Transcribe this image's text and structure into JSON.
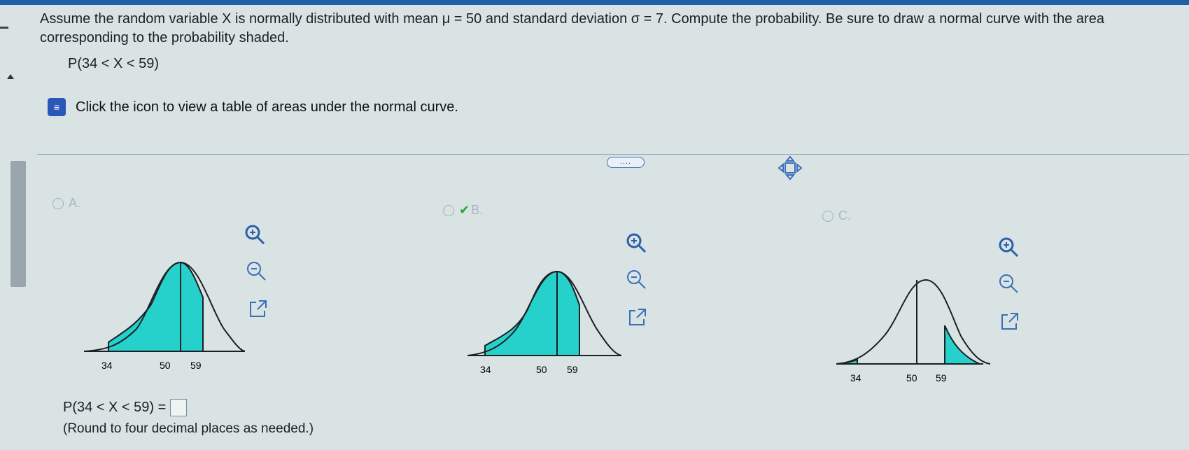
{
  "question": {
    "text": "Assume the random variable X is normally distributed with mean μ = 50 and standard deviation σ = 7. Compute the probability. Be sure to draw a normal curve with the area corresponding to the probability shaded.",
    "expression": "P(34 < X < 59)"
  },
  "help": {
    "link_text": "Click the icon to view a table of areas under the normal curve."
  },
  "more_button": "....",
  "options": [
    {
      "id": "A",
      "label": "A.",
      "ticks": [
        "34",
        "50",
        "59"
      ],
      "shading": "between 34 and 59",
      "checked": false
    },
    {
      "id": "B",
      "label": "B.",
      "ticks": [
        "34",
        "50",
        "59"
      ],
      "shading": "between 34 and 59",
      "checked": true
    },
    {
      "id": "C",
      "label": "C.",
      "ticks": [
        "34",
        "50",
        "59"
      ],
      "shading": "tails outside 34 and 59",
      "checked": false
    }
  ],
  "tools": {
    "zoom_in": "zoom-in-icon",
    "zoom_out": "zoom-out-icon",
    "popout": "popout-icon"
  },
  "answer": {
    "prompt": "P(34 < X < 59) =",
    "value": "",
    "note": "(Round to four decimal places as needed.)"
  },
  "colors": {
    "shade": "#26d1cc",
    "accent": "#1f5fa8",
    "check": "#2aa33a"
  }
}
